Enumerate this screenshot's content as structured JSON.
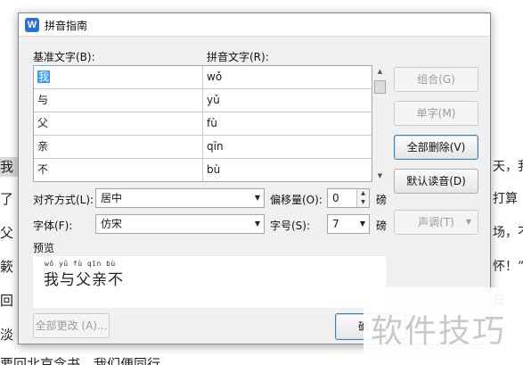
{
  "document": {
    "left_fragments": [
      "我",
      "了",
      "父",
      "簌",
      "回",
      "淡"
    ],
    "bottom_line": "要回北京念书，我们便同行。",
    "right_fragments": [
      "天，我",
      "打算",
      "场，不",
      "怀！”",
      "日"
    ]
  },
  "dialog": {
    "title": "拼音指南",
    "icon": "W",
    "base_text_label": "基准文字(B):",
    "pinyin_text_label": "拼音文字(R):",
    "rows": [
      {
        "base": "我",
        "pinyin": "wǒ"
      },
      {
        "base": "与",
        "pinyin": "yǔ"
      },
      {
        "base": "父",
        "pinyin": "fù"
      },
      {
        "base": "亲",
        "pinyin": "qīn"
      },
      {
        "base": "不",
        "pinyin": "bù"
      }
    ],
    "buttons": {
      "combine": "组合(G)",
      "single": "单字(M)",
      "delete_all": "全部删除(V)",
      "default_reading": "默认读音(D)",
      "tone": "声调(T)",
      "apply_all": "全部更改 (A)...",
      "ok": "确"
    },
    "alignment": {
      "label": "对齐方式(L):",
      "value": "居中"
    },
    "offset": {
      "label": "偏移量(O):",
      "value": "0",
      "unit": "磅"
    },
    "font": {
      "label": "字体(F):",
      "value": "仿宋"
    },
    "font_size": {
      "label": "字号(S):",
      "value": "7",
      "unit": "磅"
    },
    "preview": {
      "label": "预览",
      "ruby": "wǒ yǔ fù qīn bù",
      "text": "我与父亲不"
    }
  },
  "watermark": "软件技巧"
}
